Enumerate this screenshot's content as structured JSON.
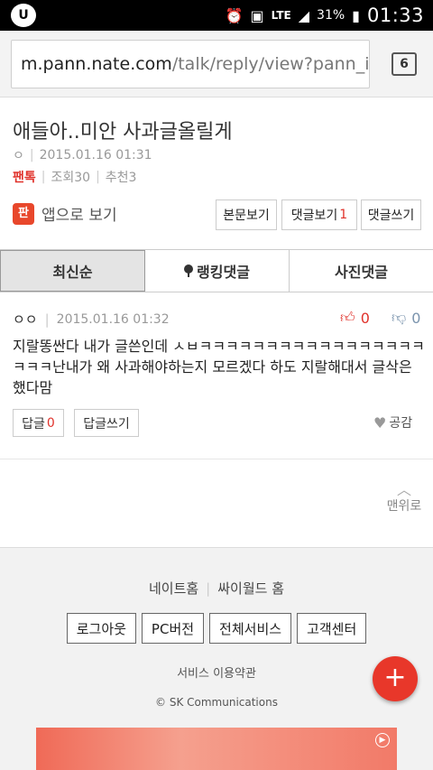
{
  "status": {
    "time": "01:33",
    "battery": "31%",
    "network": "LTE"
  },
  "browser": {
    "url_host": "m.pann.nate.com",
    "url_path": "/talk/reply/view?pann_id=.",
    "tab_count": "6"
  },
  "post": {
    "title": "애들아..미안 사과글올릴게",
    "author": "ㅇ",
    "date": "2015.01.16 01:31",
    "category": "팬톡",
    "views": "조회30",
    "recommend": "추천3"
  },
  "actions": {
    "app_view": "앱으로 보기",
    "app_icon": "판",
    "view_body": "본문보기",
    "view_comments": "댓글보기",
    "comment_count": "1",
    "write_comment": "댓글쓰기"
  },
  "tabs": [
    {
      "label": "최신순",
      "active": true
    },
    {
      "label": "랭킹댓글",
      "active": false
    },
    {
      "label": "사진댓글",
      "active": false
    }
  ],
  "comment": {
    "author": "ㅇㅇ",
    "date": "2015.01.16 01:32",
    "likes": "0",
    "dislikes": "0",
    "body": "지랄똥싼다 내가 글쓴인데 ㅅㅂㅋㅋㅋㅋㅋㅋㅋㅋㅋㅋㅋㅋㅋㅋㅋㅋㅋㅋㅋㅋ난내가 왜 사과해야하는지 모르겠다 하도 지랄해대서 글삭은 했다맘",
    "reply_label": "답글",
    "reply_count": "0",
    "write_reply": "답글쓰기",
    "empathy": "공감"
  },
  "to_top": "맨위로",
  "footer": {
    "nate_home": "네이트홈",
    "cyworld_home": "싸이월드 홈",
    "buttons": [
      "로그아웃",
      "PC버전",
      "전체서비스",
      "고객센터"
    ],
    "terms": "서비스 이용약관",
    "copyright": "© SK Communications"
  },
  "fab": "+",
  "colors": {
    "accent": "#e0322b",
    "fab": "#e8372a"
  }
}
